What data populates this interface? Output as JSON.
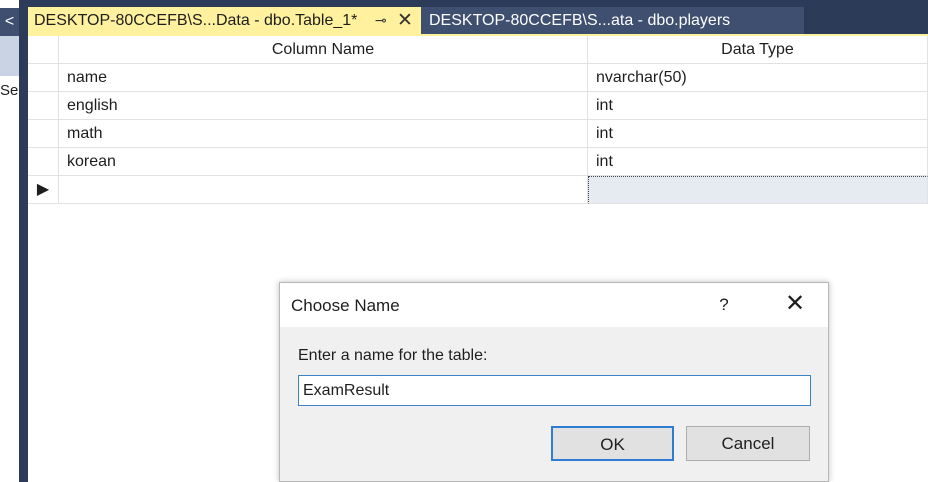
{
  "left_panel": {
    "collapse_glyph": "<",
    "fragment_text": "Se"
  },
  "tabs": [
    {
      "label": "DESKTOP-80CCEFB\\S...Data - dbo.Table_1*",
      "active": true,
      "pin_glyph": "⊸",
      "close_glyph": "✕"
    },
    {
      "label": "DESKTOP-80CCEFB\\S...ata - dbo.players",
      "active": false
    }
  ],
  "grid": {
    "columns": [
      "Column Name",
      "Data Type"
    ],
    "rows": [
      {
        "name": "name",
        "type": "nvarchar(50)"
      },
      {
        "name": "english",
        "type": "int"
      },
      {
        "name": "math",
        "type": "int"
      },
      {
        "name": "korean",
        "type": "int"
      }
    ],
    "new_row_marker": "▶"
  },
  "dialog": {
    "title": "Choose Name",
    "help_glyph": "?",
    "close_glyph": "✕",
    "prompt": "Enter a name for the table:",
    "input_value": "ExamResult",
    "ok_label": "OK",
    "cancel_label": "Cancel"
  },
  "colors": {
    "tab_active_bg": "#fff19d",
    "tab_inactive_bg": "#3e4f70",
    "chrome_bg": "#2b3b58",
    "input_border": "#3a83c6"
  }
}
